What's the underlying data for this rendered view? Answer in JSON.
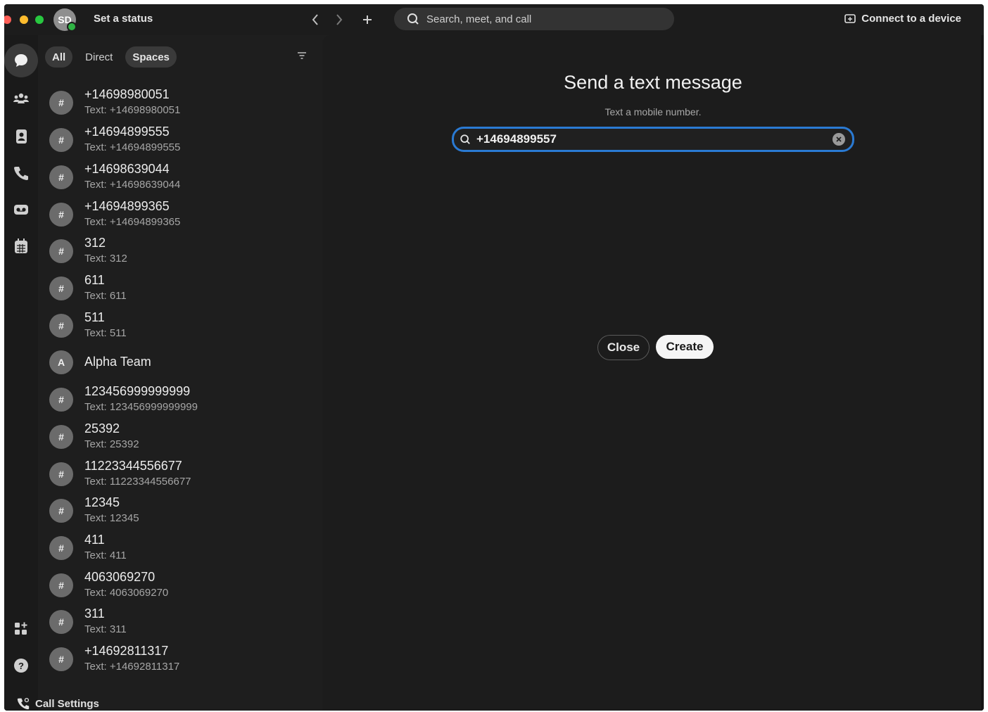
{
  "header": {
    "avatar_initials": "SD",
    "status_label": "Set a status",
    "search_placeholder": "Search, meet, and call",
    "connect_label": "Connect to a device"
  },
  "rail": {
    "icons": [
      "messaging-icon",
      "teams-icon",
      "contacts-icon",
      "calls-icon",
      "voicemail-icon",
      "calendar-icon",
      "apps-icon",
      "help-icon"
    ]
  },
  "filters": {
    "all": "All",
    "direct": "Direct",
    "spaces": "Spaces"
  },
  "list": {
    "items": [
      {
        "avatar": "#",
        "name": "+14698980051",
        "sub": "Text: +14698980051"
      },
      {
        "avatar": "#",
        "name": "+14694899555",
        "sub": "Text: +14694899555"
      },
      {
        "avatar": "#",
        "name": "+14698639044",
        "sub": "Text: +14698639044"
      },
      {
        "avatar": "#",
        "name": "+14694899365",
        "sub": "Text: +14694899365"
      },
      {
        "avatar": "#",
        "name": "312",
        "sub": "Text: 312"
      },
      {
        "avatar": "#",
        "name": "611",
        "sub": "Text: 611"
      },
      {
        "avatar": "#",
        "name": "511",
        "sub": "Text: 511"
      },
      {
        "avatar": "A",
        "name": "Alpha Team",
        "sub": ""
      },
      {
        "avatar": "#",
        "name": "123456999999999",
        "sub": "Text: 123456999999999"
      },
      {
        "avatar": "#",
        "name": "25392",
        "sub": "Text: 25392"
      },
      {
        "avatar": "#",
        "name": "11223344556677",
        "sub": "Text: 11223344556677"
      },
      {
        "avatar": "#",
        "name": "12345",
        "sub": "Text: 12345"
      },
      {
        "avatar": "#",
        "name": "411",
        "sub": "Text: 411"
      },
      {
        "avatar": "#",
        "name": "4063069270",
        "sub": "Text: 4063069270"
      },
      {
        "avatar": "#",
        "name": "311",
        "sub": "Text: 311"
      },
      {
        "avatar": "#",
        "name": "+14692811317",
        "sub": "Text: +14692811317"
      }
    ],
    "call_settings": "Call Settings"
  },
  "dialog": {
    "title": "Send a text message",
    "subtitle": "Text a mobile number.",
    "number_value": "+14694899557",
    "close_label": "Close",
    "create_label": "Create"
  },
  "colors": {
    "accent": "#2a7ad3",
    "presence": "#2fb344"
  }
}
